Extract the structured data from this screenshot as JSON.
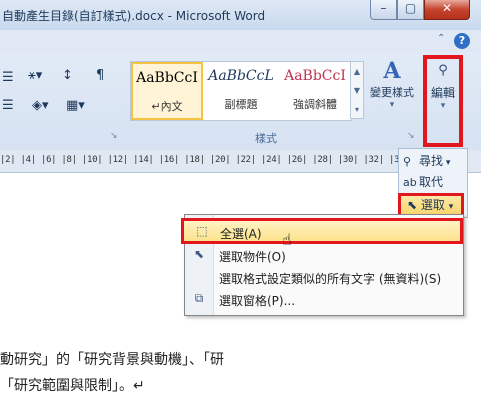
{
  "window": {
    "title": "自動產生目錄(自訂樣式).docx - Microsoft Word",
    "min_glyph": "–",
    "max_glyph": "▢",
    "close_glyph": "✕"
  },
  "ribbon": {
    "help_glyph": "?",
    "collapse_glyph": "⌃",
    "styles": [
      {
        "sample": "AaBbCcI",
        "name": "↵內文",
        "color": "#000000",
        "selected": true
      },
      {
        "sample": "AaBbCcL",
        "name": "副標題",
        "color": "#1f1f1f",
        "selected": false
      },
      {
        "sample": "AaBbCcI",
        "name": "強調斜體",
        "color": "#c0314f",
        "selected": false
      }
    ],
    "styles_group_label": "樣式",
    "change_styles": {
      "icon_text": "A",
      "label": "變更樣式",
      "arrow": "▾"
    },
    "editing": {
      "icon_text": "⚲",
      "label": "編輯",
      "arrow": "▾"
    }
  },
  "ruler": {
    "text": "|2|   |4|    |6|    |8|    |10|   |12|   |14|   |16|   |18|   |20|   |22|   |24|   |26|   |28|   |30|  |32|   |34|    |36|   |38|"
  },
  "flyout": {
    "find": "尋找",
    "replace": "取代",
    "select": "選取"
  },
  "menu": {
    "items": [
      {
        "label": "全選(A)",
        "icon": "select-all-icon"
      },
      {
        "label": "選取物件(O)",
        "icon": "select-objects-icon"
      },
      {
        "label": "選取格式設定類似的所有文字 (無資料)(S)",
        "icon": "none"
      },
      {
        "label": "選取窗格(P)...",
        "icon": "selection-pane-icon"
      }
    ]
  },
  "document": {
    "line1": "動研究」的「研究背景與動機」、「研",
    "line2": "「研究範圍與限制」。↵"
  }
}
